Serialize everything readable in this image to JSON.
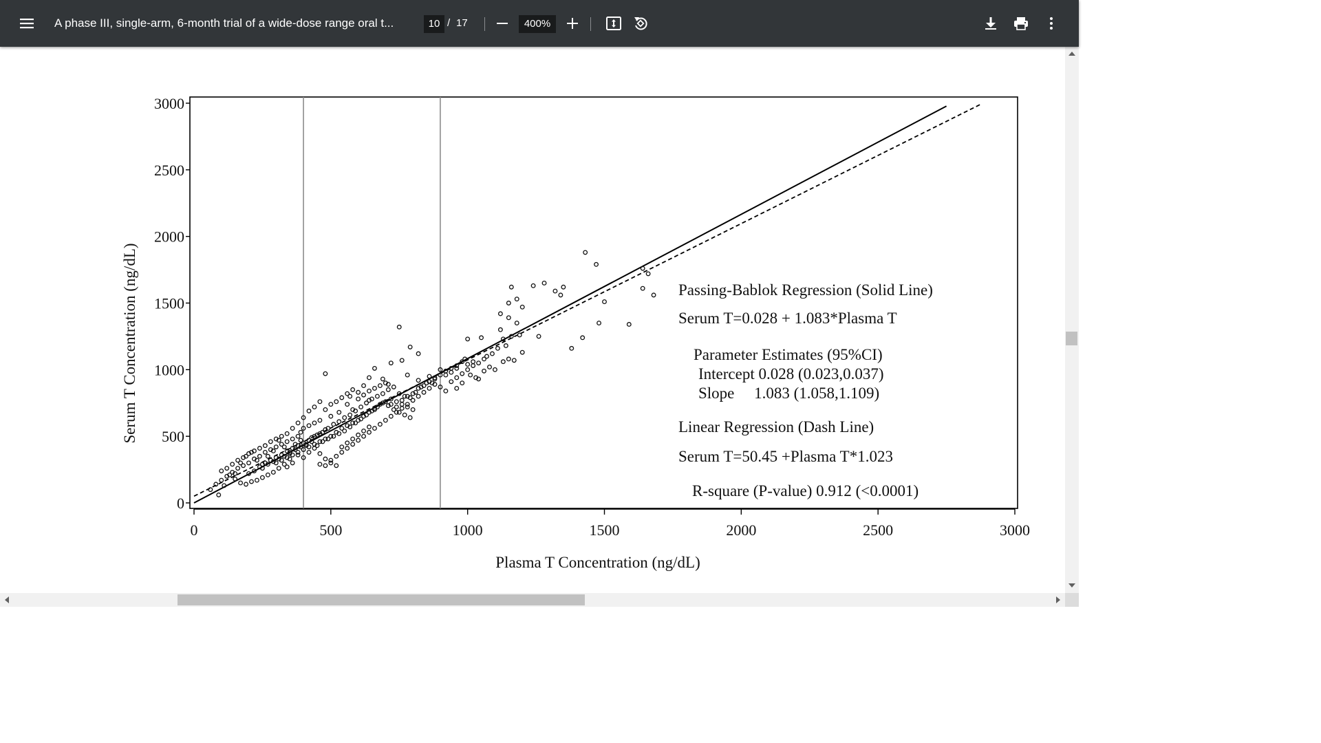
{
  "toolbar": {
    "title": "A phase III, single-arm, 6-month trial of a wide-dose range oral t...",
    "page_current": "10",
    "page_separator": "/",
    "page_total": "17",
    "zoom": "400%",
    "icons": [
      "menu-icon",
      "zoom-out-icon",
      "zoom-in-icon",
      "fit-page-icon",
      "rotate-icon",
      "download-icon",
      "print-icon",
      "more-vert-icon"
    ]
  },
  "chart_data": {
    "type": "scatter",
    "xlabel": "Plasma T Concentration (ng/dL)",
    "ylabel": "Serum T Concentration (ng/dL)",
    "xlim": [
      0,
      3000
    ],
    "ylim": [
      0,
      3000
    ],
    "xticks": [
      "0",
      "500",
      "1000",
      "1500",
      "2000",
      "2500",
      "3000"
    ],
    "yticks": [
      "0",
      "500",
      "1000",
      "1500",
      "2000",
      "2500",
      "3000"
    ],
    "vertical_reference_lines_x": [
      400,
      900
    ],
    "grid": false,
    "regression_lines": [
      {
        "style": "solid",
        "intercept": 0.028,
        "slope": 1.083,
        "x_range": [
          0,
          2750
        ]
      },
      {
        "style": "dashed",
        "intercept": 50.45,
        "slope": 1.023,
        "x_range": [
          0,
          2880
        ]
      }
    ],
    "annotations": {
      "pb_title": "Passing-Bablok Regression (Solid Line)",
      "pb_equation": "Serum T=0.028 + 1.083*Plasma T",
      "param_title": "Parameter Estimates (95%CI)",
      "param_intercept": "Intercept 0.028 (0.023,0.037)",
      "param_slope": "Slope     1.083 (1.058,1.109)",
      "lr_title": "Linear Regression (Dash Line)",
      "lr_equation": "Serum T=50.45 +Plasma T*1.023",
      "rsquare": "R-square (P-value) 0.912 (<0.0001)"
    },
    "points": [
      [
        1160,
        1620
      ],
      [
        1240,
        1630
      ],
      [
        1280,
        1650
      ],
      [
        1430,
        1880
      ],
      [
        1470,
        1790
      ],
      [
        1640,
        1760
      ],
      [
        1660,
        1720
      ],
      [
        1640,
        1610
      ],
      [
        1680,
        1560
      ],
      [
        1500,
        1510
      ],
      [
        1340,
        1560
      ],
      [
        1180,
        1530
      ],
      [
        1150,
        1500
      ],
      [
        1200,
        1470
      ],
      [
        1120,
        1420
      ],
      [
        1150,
        1390
      ],
      [
        1180,
        1350
      ],
      [
        1480,
        1350
      ],
      [
        1590,
        1340
      ],
      [
        1120,
        1300
      ],
      [
        1190,
        1260
      ],
      [
        1260,
        1250
      ],
      [
        1050,
        1240
      ],
      [
        1000,
        1230
      ],
      [
        1380,
        1160
      ],
      [
        1420,
        1240
      ],
      [
        1200,
        1130
      ],
      [
        1150,
        1080
      ],
      [
        1170,
        1070
      ],
      [
        1090,
        1120
      ],
      [
        1070,
        1100
      ],
      [
        1020,
        1060
      ],
      [
        990,
        1080
      ],
      [
        1000,
        1040
      ],
      [
        960,
        1010
      ],
      [
        900,
        1000
      ],
      [
        860,
        950
      ],
      [
        870,
        900
      ],
      [
        820,
        920
      ],
      [
        780,
        960
      ],
      [
        750,
        1320
      ],
      [
        790,
        1170
      ],
      [
        820,
        1120
      ],
      [
        760,
        1070
      ],
      [
        720,
        1050
      ],
      [
        660,
        1010
      ],
      [
        480,
        970
      ],
      [
        640,
        940
      ],
      [
        690,
        930
      ],
      [
        710,
        890
      ],
      [
        620,
        880
      ],
      [
        600,
        830
      ],
      [
        570,
        800
      ],
      [
        560,
        740
      ],
      [
        640,
        770
      ],
      [
        660,
        700
      ],
      [
        580,
        700
      ],
      [
        530,
        680
      ],
      [
        500,
        650
      ],
      [
        460,
        620
      ],
      [
        440,
        600
      ],
      [
        420,
        580
      ],
      [
        400,
        560
      ],
      [
        390,
        530
      ],
      [
        380,
        500
      ],
      [
        360,
        480
      ],
      [
        340,
        460
      ],
      [
        320,
        440
      ],
      [
        300,
        420
      ],
      [
        280,
        400
      ],
      [
        260,
        380
      ],
      [
        240,
        350
      ],
      [
        220,
        330
      ],
      [
        200,
        300
      ],
      [
        180,
        280
      ],
      [
        160,
        260
      ],
      [
        140,
        230
      ],
      [
        120,
        200
      ],
      [
        100,
        170
      ],
      [
        80,
        140
      ],
      [
        60,
        100
      ],
      [
        90,
        60
      ],
      [
        110,
        130
      ],
      [
        150,
        220
      ],
      [
        170,
        300
      ],
      [
        190,
        350
      ],
      [
        210,
        380
      ],
      [
        230,
        320
      ],
      [
        250,
        290
      ],
      [
        270,
        350
      ],
      [
        290,
        390
      ],
      [
        310,
        470
      ],
      [
        330,
        420
      ],
      [
        350,
        380
      ],
      [
        370,
        440
      ],
      [
        390,
        470
      ],
      [
        410,
        430
      ],
      [
        430,
        490
      ],
      [
        450,
        510
      ],
      [
        470,
        530
      ],
      [
        490,
        560
      ],
      [
        510,
        590
      ],
      [
        530,
        610
      ],
      [
        550,
        640
      ],
      [
        570,
        660
      ],
      [
        590,
        690
      ],
      [
        610,
        720
      ],
      [
        630,
        750
      ],
      [
        650,
        780
      ],
      [
        670,
        800
      ],
      [
        690,
        820
      ],
      [
        710,
        850
      ],
      [
        730,
        870
      ],
      [
        750,
        820
      ],
      [
        770,
        800
      ],
      [
        790,
        790
      ],
      [
        810,
        830
      ],
      [
        830,
        870
      ],
      [
        850,
        900
      ],
      [
        880,
        930
      ],
      [
        920,
        960
      ],
      [
        940,
        980
      ],
      [
        960,
        860
      ],
      [
        980,
        900
      ],
      [
        1030,
        940
      ],
      [
        1060,
        990
      ],
      [
        1080,
        1020
      ],
      [
        350,
        330
      ],
      [
        330,
        290
      ],
      [
        310,
        260
      ],
      [
        290,
        230
      ],
      [
        270,
        210
      ],
      [
        250,
        190
      ],
      [
        230,
        170
      ],
      [
        210,
        160
      ],
      [
        190,
        140
      ],
      [
        170,
        150
      ],
      [
        150,
        180
      ],
      [
        130,
        210
      ],
      [
        400,
        640
      ],
      [
        420,
        690
      ],
      [
        440,
        720
      ],
      [
        460,
        760
      ],
      [
        480,
        700
      ],
      [
        500,
        740
      ],
      [
        520,
        760
      ],
      [
        540,
        790
      ],
      [
        560,
        820
      ],
      [
        580,
        850
      ],
      [
        600,
        780
      ],
      [
        620,
        810
      ],
      [
        640,
        840
      ],
      [
        660,
        860
      ],
      [
        680,
        880
      ],
      [
        700,
        900
      ],
      [
        720,
        780
      ],
      [
        740,
        760
      ],
      [
        760,
        740
      ],
      [
        780,
        720
      ],
      [
        800,
        700
      ],
      [
        450,
        430
      ],
      [
        470,
        460
      ],
      [
        490,
        480
      ],
      [
        510,
        500
      ],
      [
        530,
        520
      ],
      [
        550,
        540
      ],
      [
        570,
        570
      ],
      [
        590,
        600
      ],
      [
        610,
        630
      ],
      [
        630,
        660
      ],
      [
        650,
        690
      ],
      [
        670,
        720
      ],
      [
        690,
        750
      ],
      [
        710,
        730
      ],
      [
        730,
        700
      ],
      [
        750,
        680
      ],
      [
        770,
        660
      ],
      [
        790,
        640
      ],
      [
        420,
        380
      ],
      [
        440,
        410
      ],
      [
        460,
        370
      ],
      [
        480,
        330
      ],
      [
        500,
        300
      ],
      [
        520,
        280
      ],
      [
        540,
        420
      ],
      [
        560,
        450
      ],
      [
        580,
        480
      ],
      [
        600,
        510
      ],
      [
        620,
        540
      ],
      [
        640,
        570
      ],
      [
        360,
        560
      ],
      [
        380,
        600
      ],
      [
        340,
        520
      ],
      [
        320,
        500
      ],
      [
        300,
        480
      ],
      [
        280,
        460
      ],
      [
        260,
        430
      ],
      [
        240,
        410
      ],
      [
        220,
        390
      ],
      [
        200,
        370
      ],
      [
        180,
        340
      ],
      [
        160,
        320
      ],
      [
        140,
        290
      ],
      [
        120,
        260
      ],
      [
        100,
        240
      ],
      [
        380,
        360
      ],
      [
        400,
        340
      ],
      [
        360,
        300
      ],
      [
        340,
        270
      ],
      [
        460,
        290
      ],
      [
        480,
        280
      ],
      [
        500,
        320
      ],
      [
        520,
        350
      ],
      [
        540,
        380
      ],
      [
        560,
        410
      ],
      [
        580,
        440
      ],
      [
        600,
        470
      ],
      [
        620,
        500
      ],
      [
        640,
        530
      ],
      [
        660,
        560
      ],
      [
        680,
        590
      ],
      [
        700,
        620
      ],
      [
        720,
        650
      ],
      [
        740,
        680
      ],
      [
        760,
        710
      ],
      [
        780,
        740
      ],
      [
        800,
        770
      ],
      [
        820,
        800
      ],
      [
        840,
        830
      ],
      [
        860,
        860
      ],
      [
        880,
        890
      ],
      [
        900,
        870
      ],
      [
        920,
        840
      ],
      [
        940,
        910
      ],
      [
        960,
        940
      ],
      [
        980,
        970
      ],
      [
        1000,
        1000
      ],
      [
        1020,
        1030
      ],
      [
        1040,
        1050
      ],
      [
        1060,
        1080
      ],
      [
        1100,
        1000
      ],
      [
        1130,
        1060
      ],
      [
        1040,
        930
      ],
      [
        1010,
        960
      ],
      [
        1110,
        1160
      ],
      [
        1140,
        1180
      ],
      [
        1130,
        1230
      ],
      [
        1160,
        1250
      ],
      [
        1320,
        1590
      ],
      [
        1350,
        1620
      ],
      [
        300,
        340
      ],
      [
        320,
        360
      ],
      [
        340,
        390
      ],
      [
        360,
        410
      ],
      [
        380,
        430
      ],
      [
        400,
        450
      ],
      [
        420,
        470
      ],
      [
        440,
        500
      ],
      [
        460,
        520
      ],
      [
        480,
        550
      ],
      [
        250,
        260
      ],
      [
        270,
        290
      ],
      [
        290,
        310
      ],
      [
        310,
        330
      ],
      [
        330,
        350
      ],
      [
        350,
        370
      ],
      [
        370,
        400
      ],
      [
        390,
        420
      ],
      [
        410,
        440
      ],
      [
        430,
        460
      ],
      [
        200,
        220
      ],
      [
        220,
        240
      ],
      [
        240,
        270
      ],
      [
        260,
        300
      ],
      [
        280,
        320
      ],
      [
        300,
        300
      ],
      [
        320,
        320
      ],
      [
        340,
        340
      ],
      [
        360,
        360
      ],
      [
        380,
        380
      ],
      [
        400,
        400
      ],
      [
        420,
        420
      ],
      [
        440,
        440
      ],
      [
        460,
        460
      ],
      [
        480,
        480
      ],
      [
        500,
        500
      ],
      [
        520,
        530
      ],
      [
        540,
        560
      ],
      [
        560,
        580
      ],
      [
        580,
        600
      ],
      [
        600,
        620
      ],
      [
        620,
        650
      ],
      [
        640,
        680
      ],
      [
        660,
        710
      ],
      [
        680,
        740
      ],
      [
        700,
        760
      ],
      [
        720,
        740
      ],
      [
        740,
        720
      ],
      [
        760,
        770
      ],
      [
        780,
        800
      ],
      [
        800,
        820
      ],
      [
        820,
        860
      ],
      [
        840,
        880
      ],
      [
        860,
        910
      ],
      [
        880,
        940
      ],
      [
        900,
        960
      ],
      [
        920,
        990
      ],
      [
        940,
        1010
      ],
      [
        960,
        1030
      ],
      [
        980,
        1060
      ]
    ]
  }
}
